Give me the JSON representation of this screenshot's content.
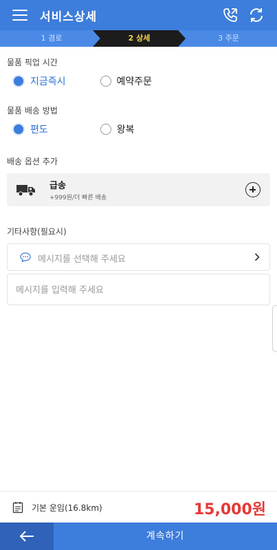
{
  "header": {
    "title": "서비스상세",
    "bg_color": "#3d7ddc",
    "icons": [
      "menu-icon",
      "phone-icon",
      "refresh-icon"
    ]
  },
  "steps": [
    {
      "label": "1 경로",
      "active": false
    },
    {
      "label": "2 상세",
      "active": true
    },
    {
      "label": "3 주문",
      "active": false
    }
  ],
  "pickup": {
    "label": "물품 픽업 시간",
    "options": [
      {
        "label": "지금즉시",
        "selected": true
      },
      {
        "label": "예약주문",
        "selected": false
      }
    ]
  },
  "delivery": {
    "label": "물품 배송 방법",
    "options": [
      {
        "label": "편도",
        "selected": true
      },
      {
        "label": "왕복",
        "selected": false
      }
    ]
  },
  "option_section": {
    "label": "배송 옵션 추가",
    "item": {
      "title": "급송",
      "subtitle": "+999원/더 빠른 배송",
      "icon": "truck-icon"
    }
  },
  "notes": {
    "label": "기타사항(필요시)",
    "select_placeholder": "메시지를 선택해 주세요",
    "input_placeholder": "메시지를 입력해 주세요"
  },
  "fare": {
    "label": "기본 운임(16.8km)",
    "amount": "15,000원",
    "amount_color": "#e53935"
  },
  "footer": {
    "continue_label": "계속하기",
    "back_icon": "arrow-left-icon"
  }
}
